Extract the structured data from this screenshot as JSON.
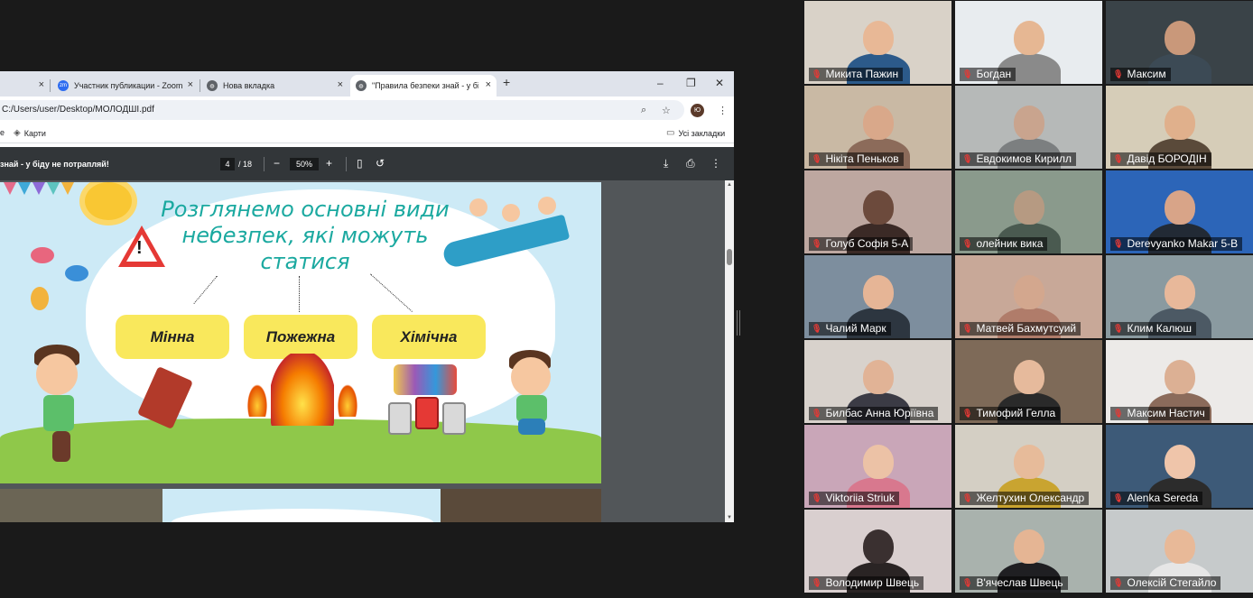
{
  "browser": {
    "tabs": [
      {
        "label": "",
        "close": "×"
      },
      {
        "label": "Участник публикации - Zoom",
        "close": "×",
        "icon_text": "zm"
      },
      {
        "label": "Нова вкладка",
        "close": "×"
      },
      {
        "label": "\"Правила безпеки знай - у біду",
        "close": "×"
      }
    ],
    "new_tab": "+",
    "window_controls": {
      "minimize": "–",
      "restore": "❐",
      "close": "✕"
    },
    "address": "C:/Users/user/Desktop/МОЛОДШІ.pdf",
    "profile_initials": "Ю",
    "bookmarks": [
      {
        "label": "е"
      },
      {
        "label": "Карти"
      }
    ],
    "all_bookmarks": "Усі закладки"
  },
  "pdf": {
    "title": "знай - у біду не потрапляй!",
    "page_current": "4",
    "page_total": "/ 18",
    "zoom": "50%",
    "zoom_out": "−",
    "zoom_in": "+"
  },
  "slide": {
    "title_line1": "Розглянемо основні види",
    "title_line2": "небезпек, які можуть",
    "title_line3": "статися",
    "warning_mark": "!",
    "categories": [
      "Мінна",
      "Пожежна",
      "Хімічна"
    ]
  },
  "participants": [
    {
      "name": "Микита Пажин",
      "bg": "#d9d2c8",
      "face": "#e8b896",
      "shirt": "#2c5a8a"
    },
    {
      "name": "Богдан",
      "bg": "#e8ecef",
      "face": "#e6b793",
      "shirt": "#8a8a8a"
    },
    {
      "name": "Максим",
      "bg": "#3a4348",
      "face": "#c9987a",
      "shirt": "#3c4a55"
    },
    {
      "name": "Нікіта Пеньков",
      "bg": "#c9b9a4",
      "face": "#d9a88a",
      "shirt": "#8c6b5a"
    },
    {
      "name": "Евдокимов Кирилл",
      "bg": "#b6b9b8",
      "face": "#c9a48e",
      "shirt": "#7c7f80"
    },
    {
      "name": "Давід БОРОДІН",
      "bg": "#d6cdb8",
      "face": "#e0b08c",
      "shirt": "#5a4a3a"
    },
    {
      "name": "Голуб Софія 5-А",
      "bg": "#bda7a0",
      "face": "#6c4a3c",
      "shirt": "#3b2a26"
    },
    {
      "name": "олейник вика",
      "bg": "#8a9a8c",
      "face": "#b69a82",
      "shirt": "#4a5a50"
    },
    {
      "name": "Derevyanko Makar 5-В",
      "bg": "#2c65b8",
      "face": "#d8a488",
      "shirt": "#222a35"
    },
    {
      "name": "Чалий Марк",
      "bg": "#7d8e9e",
      "face": "#e6b596",
      "shirt": "#2d3640"
    },
    {
      "name": "Матвей Бахмутсуий",
      "bg": "#c8a898",
      "face": "#d3a78e",
      "shirt": "#b07c6a"
    },
    {
      "name": "Клим Калюш",
      "bg": "#8a9aa0",
      "face": "#e8b89a",
      "shirt": "#4c5964"
    },
    {
      "name": "Билбас Анна Юріївна",
      "bg": "#d8d2cc",
      "face": "#e1b396",
      "shirt": "#3b3b45"
    },
    {
      "name": "Тимофий Гелла",
      "bg": "#7e6a58",
      "face": "#e6ba9c",
      "shirt": "#2a2a2a"
    },
    {
      "name": "Максим  Настич",
      "bg": "#eceae8",
      "face": "#dcb094",
      "shirt": "#8b6b5b"
    },
    {
      "name": "Viktoriia Striuk",
      "bg": "#c9a6b8",
      "face": "#ecc2a6",
      "shirt": "#d8788e"
    },
    {
      "name": "Желтухин Олександр",
      "bg": "#d4cfc4",
      "face": "#e7bb9a",
      "shirt": "#c9a430"
    },
    {
      "name": "Alenka Sereda",
      "bg": "#3d5a78",
      "face": "#efc5aa",
      "shirt": "#2c2c2c"
    },
    {
      "name": "Володимир Швець",
      "bg": "#d9cfcf",
      "face": "#3a3030",
      "shirt": "#2a2424"
    },
    {
      "name": "В'ячеслав Швець",
      "bg": "#a9b2ad",
      "face": "#e5b594",
      "shirt": "#1f1f22"
    },
    {
      "name": "Олексій Стегайло",
      "bg": "#c6cacb",
      "face": "#e8b998",
      "shirt": "#e6e6e6"
    }
  ]
}
